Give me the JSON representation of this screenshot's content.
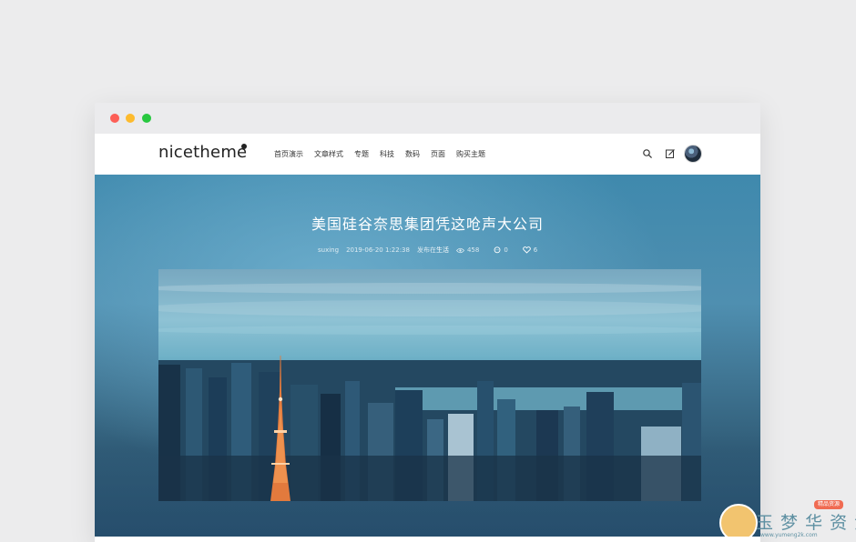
{
  "site": {
    "logo": "nicetheme",
    "nav": [
      "首页演示",
      "文章样式",
      "专题",
      "科技",
      "数码",
      "页面",
      "购买主题"
    ]
  },
  "header_icons": [
    "search-icon",
    "edit-icon",
    "avatar"
  ],
  "post": {
    "title": "美国硅谷奈思集团凭这呛声大公司",
    "author": "suxing",
    "date": "2019-06-20 1:22:38",
    "category_prefix": "发布在",
    "category": "生活",
    "views": "458",
    "comments": "0",
    "likes": "6"
  },
  "watermark": {
    "text": "玉 梦 华 资 源 网",
    "sub": "www.yumeng2k.com",
    "tag": "精品资源"
  },
  "colors": {
    "hero_blue": "#3f89ad",
    "dark_blue": "#2d5670",
    "header_bg": "#ffffff",
    "traffic_red": "#fd5f57",
    "traffic_yellow": "#fdbb2e",
    "traffic_green": "#28c840"
  }
}
